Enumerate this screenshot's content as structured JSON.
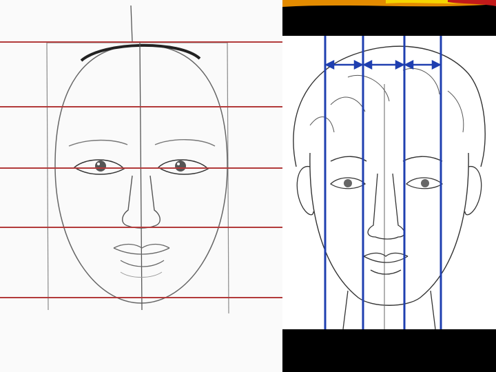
{
  "slide": {
    "background": "#000000",
    "accent_colors": [
      "#f5d400",
      "#e38b00",
      "#c21a1a",
      "#0d7a2e"
    ]
  },
  "left_figure": {
    "description_icon": "face-proportion-horizontal-lines",
    "guide_line_color": "#b23a3a",
    "sketch_color": "#6e6e6e"
  },
  "right_figure": {
    "description_icon": "face-proportion-vertical-lines",
    "guide_line_color": "#1f3fb0",
    "sketch_color": "#333333"
  }
}
